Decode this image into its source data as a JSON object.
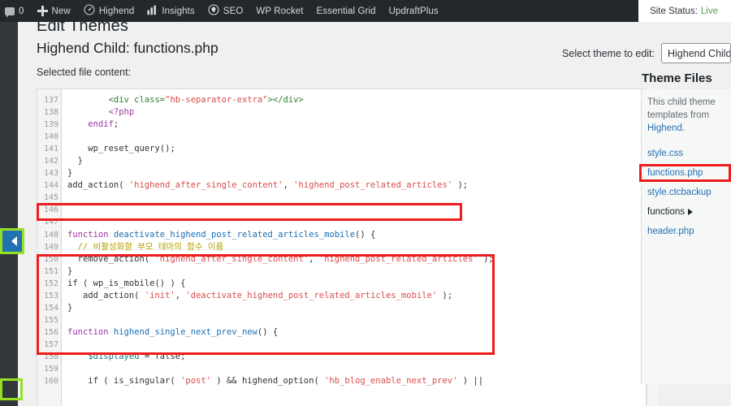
{
  "adminbar": {
    "items": [
      {
        "icon": "comment-icon",
        "label": "0"
      },
      {
        "icon": "plus-icon",
        "label": "New"
      },
      {
        "icon": "speedometer-icon",
        "label": "Highend"
      },
      {
        "icon": "bar-chart-icon",
        "label": "Insights"
      },
      {
        "icon": "seo-badge-icon",
        "label": "SEO"
      },
      {
        "icon": "",
        "label": "WP Rocket"
      },
      {
        "icon": "",
        "label": "Essential Grid"
      },
      {
        "icon": "",
        "label": "UpdraftPlus"
      }
    ],
    "site_status_label": "Site Status:",
    "site_status_value": "Live",
    "site_status_color": "#5b9e54"
  },
  "page": {
    "title": "Edit Themes",
    "heading": "Highend Child: functions.php",
    "selected_file_label": "Selected file content:",
    "select_theme_label": "Select theme to edit:",
    "selected_theme": "Highend Child"
  },
  "theme_files": {
    "title": "Theme Files",
    "note_line1": "This child theme",
    "note_line2": "templates from",
    "note_link": "Highend.",
    "files": [
      {
        "name": "style.css",
        "type": "file",
        "active": false
      },
      {
        "name": "functions.php",
        "type": "file",
        "active": true
      },
      {
        "name": "style.ctcbackup",
        "type": "file",
        "active": false
      },
      {
        "name": "functions",
        "type": "folder",
        "active": false
      },
      {
        "name": "header.php",
        "type": "file",
        "active": false
      }
    ]
  },
  "editor": {
    "first_line": 137,
    "lines": [
      {
        "n": 137,
        "tokens": [
          {
            "t": "        ",
            "c": "plain"
          },
          {
            "t": "<div class=",
            "c": "html"
          },
          {
            "t": "\"hb-separator-extra\"",
            "c": "str"
          },
          {
            "t": "></div>",
            "c": "html"
          }
        ]
      },
      {
        "n": 138,
        "tokens": [
          {
            "t": "        ",
            "c": "plain"
          },
          {
            "t": "<?php",
            "c": "php"
          }
        ]
      },
      {
        "n": 139,
        "tokens": [
          {
            "t": "    ",
            "c": "plain"
          },
          {
            "t": "endif",
            "c": "kw"
          },
          {
            "t": ";",
            "c": "plain"
          }
        ]
      },
      {
        "n": 140,
        "tokens": []
      },
      {
        "n": 141,
        "tokens": [
          {
            "t": "    ",
            "c": "plain"
          },
          {
            "t": "wp_reset_query",
            "c": "plain"
          },
          {
            "t": "();",
            "c": "plain"
          }
        ]
      },
      {
        "n": 142,
        "tokens": [
          {
            "t": "  }",
            "c": "plain"
          }
        ]
      },
      {
        "n": 143,
        "tokens": [
          {
            "t": "}",
            "c": "plain"
          }
        ]
      },
      {
        "n": 144,
        "tokens": [
          {
            "t": "add_action( ",
            "c": "plain"
          },
          {
            "t": "'highend_after_single_content'",
            "c": "str"
          },
          {
            "t": ", ",
            "c": "plain"
          },
          {
            "t": "'highend_post_related_articles'",
            "c": "str"
          },
          {
            "t": " );",
            "c": "plain"
          }
        ]
      },
      {
        "n": 145,
        "tokens": []
      },
      {
        "n": 146,
        "tokens": []
      },
      {
        "n": 147,
        "tokens": []
      },
      {
        "n": 148,
        "tokens": [
          {
            "t": "function",
            "c": "kw"
          },
          {
            "t": " deactivate_highend_post_related_articles_mobile",
            "c": "fn"
          },
          {
            "t": "() {",
            "c": "plain"
          }
        ]
      },
      {
        "n": 149,
        "tokens": [
          {
            "t": "  // 비활성화할 부모 테마의 함수 이름",
            "c": "cmt"
          }
        ]
      },
      {
        "n": 150,
        "tokens": [
          {
            "t": "  remove_action( ",
            "c": "plain"
          },
          {
            "t": "'highend_after_single_content'",
            "c": "str"
          },
          {
            "t": ", ",
            "c": "plain"
          },
          {
            "t": "'highend_post_related_articles'",
            "c": "str"
          },
          {
            "t": " );",
            "c": "plain"
          }
        ]
      },
      {
        "n": 151,
        "tokens": [
          {
            "t": "}",
            "c": "plain"
          }
        ]
      },
      {
        "n": 152,
        "tokens": [
          {
            "t": "if",
            "c": "plain"
          },
          {
            "t": " ( wp_is_mobile() ) {",
            "c": "plain"
          }
        ]
      },
      {
        "n": 153,
        "tokens": [
          {
            "t": "   add_action( ",
            "c": "plain"
          },
          {
            "t": "'init'",
            "c": "str"
          },
          {
            "t": ", ",
            "c": "plain"
          },
          {
            "t": "'deactivate_highend_post_related_articles_mobile'",
            "c": "str"
          },
          {
            "t": " );",
            "c": "plain"
          }
        ]
      },
      {
        "n": 154,
        "tokens": [
          {
            "t": "}",
            "c": "plain"
          }
        ]
      },
      {
        "n": 155,
        "tokens": []
      },
      {
        "n": 156,
        "tokens": [
          {
            "t": "function",
            "c": "kw"
          },
          {
            "t": " highend_single_next_prev_new",
            "c": "fn"
          },
          {
            "t": "() {",
            "c": "plain"
          }
        ]
      },
      {
        "n": 157,
        "tokens": []
      },
      {
        "n": 158,
        "tokens": [
          {
            "t": "    ",
            "c": "plain"
          },
          {
            "t": "$displayed",
            "c": "var"
          },
          {
            "t": " = false;",
            "c": "plain"
          }
        ]
      },
      {
        "n": 159,
        "tokens": []
      },
      {
        "n": 160,
        "tokens": [
          {
            "t": "    if ( is_singular( ",
            "c": "plain"
          },
          {
            "t": "'post'",
            "c": "str"
          },
          {
            "t": " ) && highend_option( ",
            "c": "plain"
          },
          {
            "t": "'hb_blog_enable_next_prev'",
            "c": "str"
          },
          {
            "t": " ) ||",
            "c": "plain"
          }
        ]
      }
    ]
  },
  "annotations": {
    "red_color": "#ee1c1c",
    "green_color": "#96e024",
    "blue_color": "#2271b1"
  }
}
